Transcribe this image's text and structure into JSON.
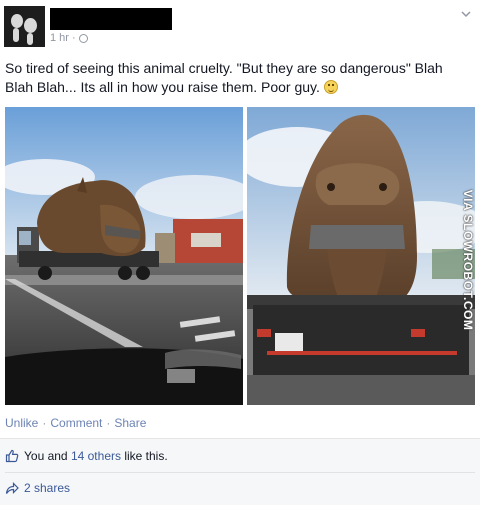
{
  "post": {
    "time": "1 hr",
    "visibility_icon": "globe-icon",
    "text": "So tired of seeing this animal cruelty. \"But they are so dangerous\" Blah Blah Blah... Its all in how you raise them. Poor guy.",
    "emoji_icon": "sad-smiley-icon"
  },
  "photos": {
    "left_alt": "Truck carrying a dinosaur statue on a highway",
    "right_alt": "Rear view of truck hauling a tied-up T-rex",
    "watermark": "VIA SLOWROBOT.COM"
  },
  "actions": {
    "unlike": "Unlike",
    "sep1": "·",
    "comment": "Comment",
    "sep2": "·",
    "share": "Share"
  },
  "likes": {
    "prefix": "You and ",
    "others": "14 others",
    "suffix": " like this."
  },
  "shares": {
    "label": "2 shares"
  },
  "colors": {
    "link": "#3b5998",
    "muted": "#9197a3",
    "action": "#6d84b4"
  }
}
